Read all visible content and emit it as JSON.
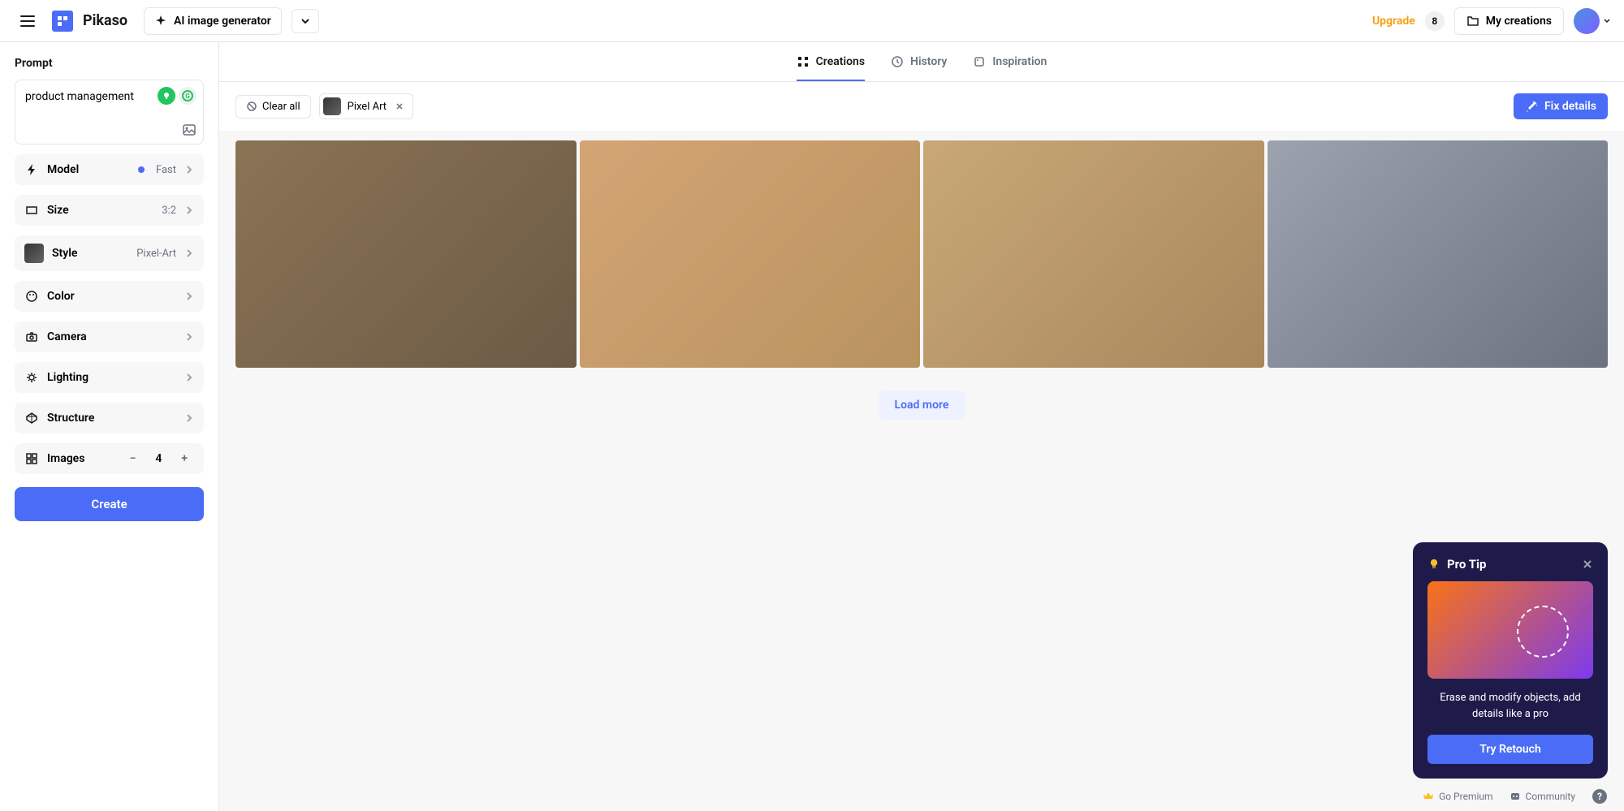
{
  "topbar": {
    "brand": "Pikaso",
    "aiGenLabel": "AI image generator",
    "upgrade": "Upgrade",
    "badgeCount": "8",
    "myCreations": "My creations"
  },
  "sidebar": {
    "promptLabel": "Prompt",
    "promptValue": "product management",
    "settings": {
      "model": {
        "label": "Model",
        "value": "Fast"
      },
      "size": {
        "label": "Size",
        "value": "3:2"
      },
      "style": {
        "label": "Style",
        "value": "Pixel-Art"
      },
      "color": {
        "label": "Color"
      },
      "camera": {
        "label": "Camera"
      },
      "lighting": {
        "label": "Lighting"
      },
      "structure": {
        "label": "Structure"
      }
    },
    "images": {
      "label": "Images",
      "value": "4"
    },
    "createLabel": "Create"
  },
  "tabs": {
    "creations": "Creations",
    "history": "History",
    "inspiration": "Inspiration"
  },
  "toolbar": {
    "clearAll": "Clear all",
    "filterLabel": "Pixel Art",
    "fixDetails": "Fix details"
  },
  "loadMore": "Load more",
  "tip": {
    "title": "Pro Tip",
    "text": "Erase and modify objects, add details like a pro",
    "button": "Try Retouch"
  },
  "footer": {
    "goPremium": "Go Premium",
    "community": "Community"
  }
}
